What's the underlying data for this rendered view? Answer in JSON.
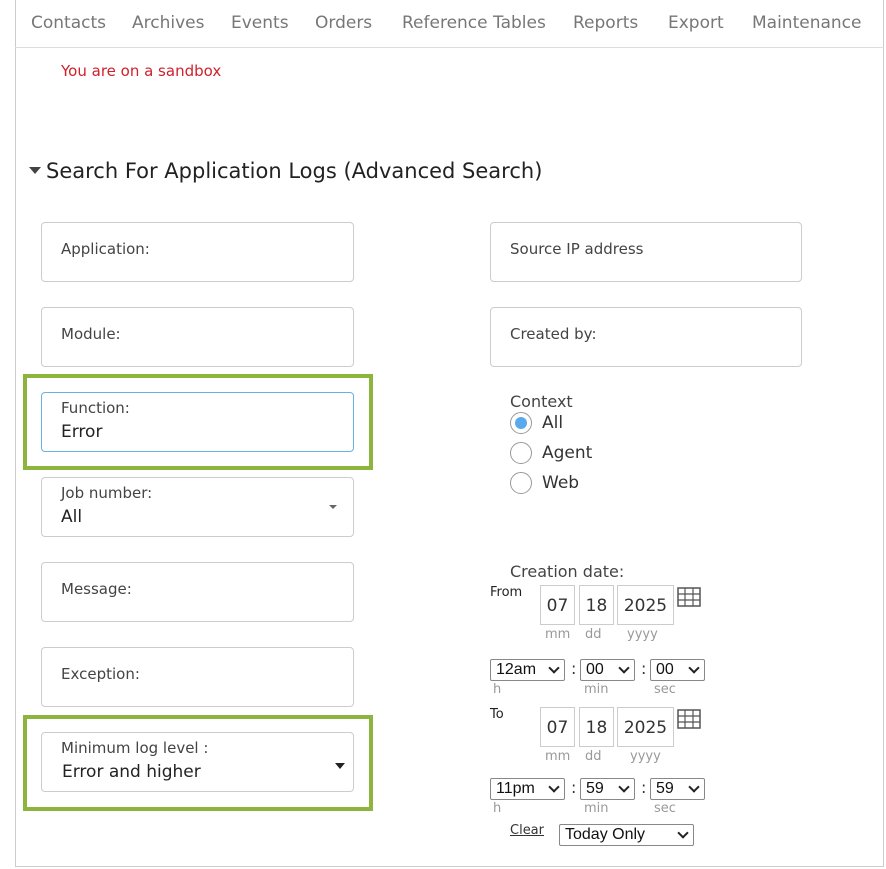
{
  "nav": {
    "items": [
      "Contacts",
      "Archives",
      "Events",
      "Orders",
      "Reference Tables",
      "Reports",
      "Export",
      "Maintenance"
    ]
  },
  "sandbox_notice": "You are on a sandbox",
  "section_title": "Search For Application Logs (Advanced Search)",
  "fields": {
    "application": {
      "label": "Application:"
    },
    "module": {
      "label": "Module:"
    },
    "function": {
      "label": "Function:",
      "value": "Error"
    },
    "job_number": {
      "label": "Job number:",
      "value": "All"
    },
    "message": {
      "label": "Message:"
    },
    "exception": {
      "label": "Exception:"
    },
    "min_log_level": {
      "label": "Minimum log level :",
      "value": "Error and higher"
    },
    "source_ip": {
      "label": "Source IP address"
    },
    "created_by": {
      "label": "Created by:"
    }
  },
  "context": {
    "label": "Context",
    "options": [
      "All",
      "Agent",
      "Web"
    ],
    "selected": "All"
  },
  "creation_date": {
    "label": "Creation date:",
    "from": {
      "label": "From",
      "mm": "07",
      "dd": "18",
      "yyyy": "2025",
      "h": "12am",
      "min": "00",
      "sec": "00"
    },
    "to": {
      "label": "To",
      "mm": "07",
      "dd": "18",
      "yyyy": "2025",
      "h": "11pm",
      "min": "59",
      "sec": "59"
    },
    "captions": {
      "mm": "mm",
      "dd": "dd",
      "yyyy": "yyyy",
      "h": "h",
      "min": "min",
      "sec": "sec"
    },
    "colon": ":",
    "clear_label": "Clear",
    "range_value": "Today Only"
  },
  "colors": {
    "highlight": "#8db43c",
    "radio_selected": "#5aa9ec",
    "sandbox": "#d0202a"
  },
  "icons": {
    "calendar": "calendar-icon",
    "collapse": "caret-down-icon"
  }
}
